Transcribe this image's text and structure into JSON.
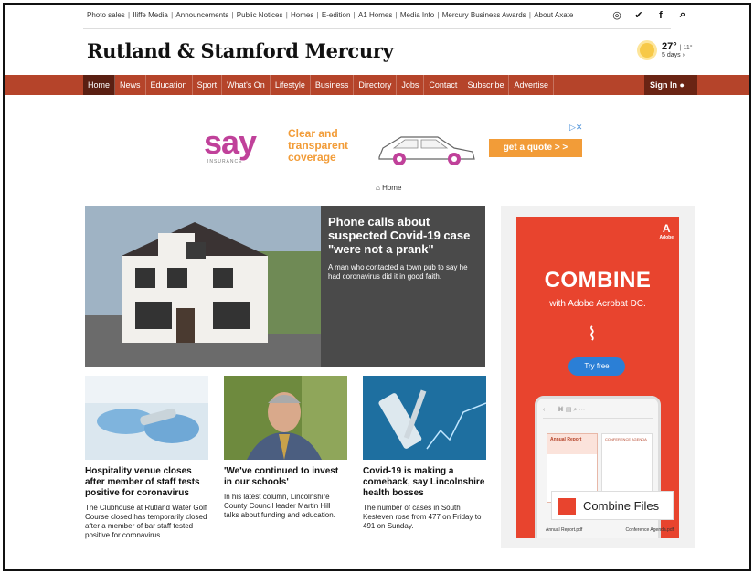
{
  "top_links": [
    "Photo sales",
    "Iliffe Media",
    "Announcements",
    "Public Notices",
    "Homes",
    "E-edition",
    "A1 Homes",
    "Media Info",
    "Mercury Business Awards",
    "About Axate"
  ],
  "social_icons": [
    "instagram-icon",
    "twitter-icon",
    "facebook-icon",
    "search-icon"
  ],
  "site_title": "Rutland & Stamford Mercury",
  "weather": {
    "temp": "27°",
    "low": "| 11°",
    "forecast": "5 days ›"
  },
  "nav": [
    "Home",
    "News",
    "Education",
    "Sport",
    "What's On",
    "Lifestyle",
    "Business",
    "Directory",
    "Jobs",
    "Contact",
    "Subscribe",
    "Advertise"
  ],
  "sign_in": "Sign In",
  "ad_banner": {
    "brand": "say",
    "brand_sub": "INSURANCE",
    "tagline_1": "Clear and",
    "tagline_2": "transparent",
    "tagline_3": "coverage",
    "cta": "get a quote > >"
  },
  "breadcrumb": "Home",
  "hero": {
    "headline": "Phone calls about suspected Covid-19 case \"were not a prank\"",
    "summary": "A man who contacted a town pub to say he had coronavirus did it in good faith."
  },
  "cards": [
    {
      "headline": "Hospitality venue closes after member of staff tests positive for coronavirus",
      "summary": "The Clubhouse at Rutland Water Golf Course closed has temporarily closed after a member of bar staff tested positive for coronavirus."
    },
    {
      "headline": "'We've continued to invest in our schools'",
      "summary": "In his latest column, Lincolnshire County Council leader Martin Hill talks about funding and education."
    },
    {
      "headline": "Covid-19 is making a comeback, say Lincolnshire health bosses",
      "summary": "The number of cases in South Kesteven rose from 477 on Friday to 491 on Sunday."
    }
  ],
  "side_ad": {
    "brand": "Adobe",
    "headline": "COMBINE",
    "sub": "with Adobe Acrobat DC.",
    "cta": "Try free",
    "doc_title": "Annual Report",
    "doc2_title": "CONFERENCE AGENDA",
    "badge": "Combine Files",
    "file1": "Annual Report.pdf",
    "file2": "Conference Agenda.pdf"
  },
  "colors": {
    "nav_bg": "#b5442a",
    "nav_active": "#5a1f12",
    "ad_red": "#e8442e",
    "say_pink": "#c0419a",
    "say_orange": "#f29c38"
  }
}
